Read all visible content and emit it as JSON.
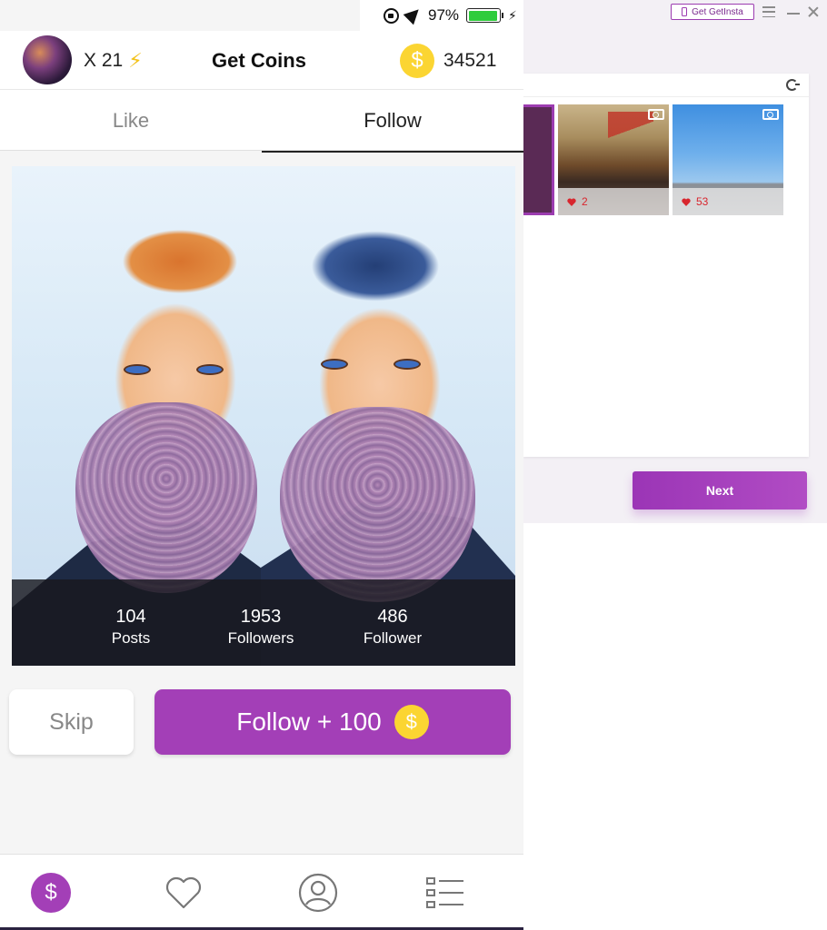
{
  "desktop": {
    "get_button_label": "Get GetInsta",
    "thumbnails": [
      {
        "likes": ""
      },
      {
        "likes": "2"
      },
      {
        "likes": "53"
      }
    ],
    "next_label": "Next"
  },
  "status_bar": {
    "battery_text": "97%",
    "battery_level": 0.97
  },
  "header": {
    "multiplier": "X 21",
    "title": "Get Coins",
    "coin_symbol": "$",
    "balance": "34521"
  },
  "tabs": [
    {
      "label": "Like",
      "active": false
    },
    {
      "label": "Follow",
      "active": true
    }
  ],
  "profile": {
    "stats": [
      {
        "value": "104",
        "label": "Posts"
      },
      {
        "value": "1953",
        "label": "Followers"
      },
      {
        "value": "486",
        "label": "Follower"
      }
    ]
  },
  "actions": {
    "skip_label": "Skip",
    "follow_label": "Follow + 100",
    "coin_symbol": "$"
  },
  "bottom_nav": {
    "coin_symbol": "$",
    "items": [
      "coins-icon",
      "heart-icon",
      "profile-icon",
      "list-icon"
    ]
  },
  "colors": {
    "accent": "#a33fb7",
    "coin": "#fbd532",
    "battery": "#2ecc3c"
  }
}
